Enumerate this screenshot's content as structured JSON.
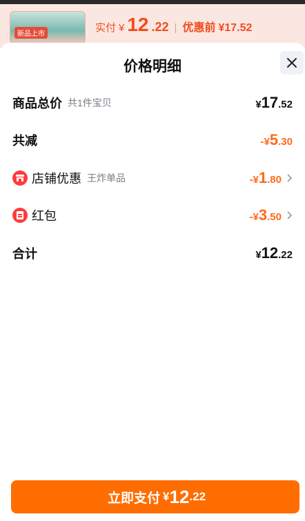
{
  "background": {
    "thumb_tag": "新品上市",
    "actual_label": "实付",
    "currency": "¥",
    "actual_int": "12",
    "actual_dec": ".22",
    "orig_label": "优惠前",
    "orig_price": "¥17.52"
  },
  "sheet": {
    "title": "价格明细",
    "rows": {
      "total": {
        "label": "商品总价",
        "sub": "共1件宝贝",
        "sym": "¥",
        "int": "17",
        "dec": ".52"
      },
      "reduce": {
        "label": "共减",
        "sym": "-¥",
        "int": "5",
        "dec": ".30"
      },
      "shop": {
        "label": "店铺优惠",
        "sub": "王炸单品",
        "sym": "-¥",
        "int": "1",
        "dec": ".80"
      },
      "redpacket": {
        "label": "红包",
        "sym": "-¥",
        "int": "3",
        "dec": ".50"
      },
      "sum": {
        "label": "合计",
        "sym": "¥",
        "int": "12",
        "dec": ".22"
      }
    }
  },
  "pay_button": {
    "label": "立即支付",
    "sym": "¥",
    "int": "12",
    "dec": ".22"
  },
  "colors": {
    "accent": "#ff6d00",
    "discount": "#ff6a1a",
    "icon_red": "#ff3b3b"
  }
}
